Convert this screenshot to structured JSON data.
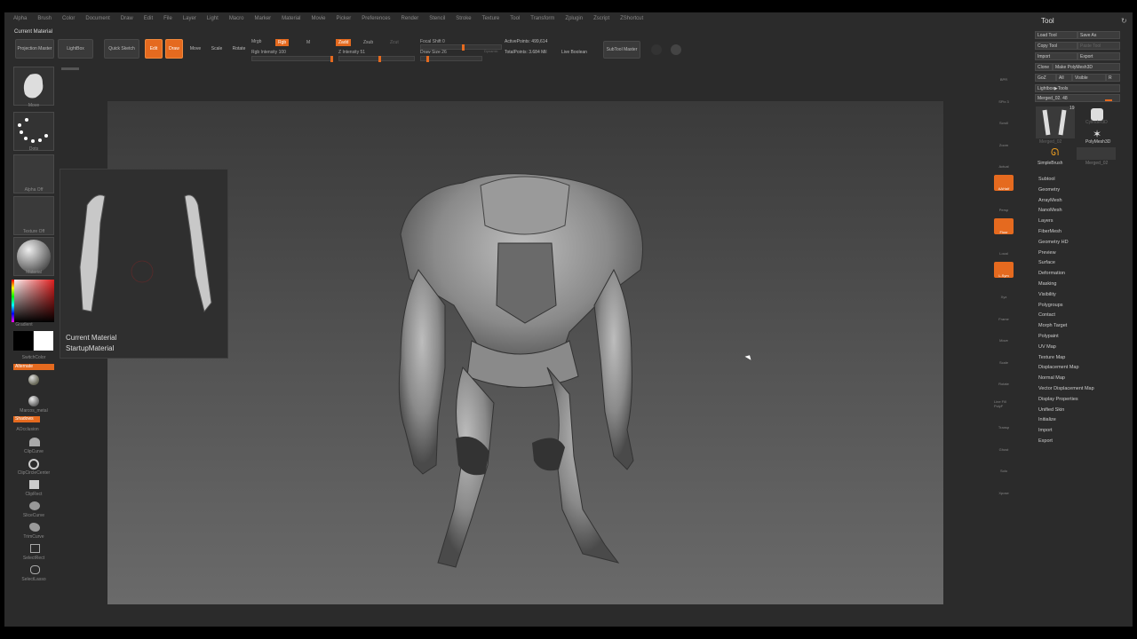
{
  "menu": [
    "Alpha",
    "Brush",
    "Color",
    "Document",
    "Draw",
    "Edit",
    "File",
    "Layer",
    "Light",
    "Macro",
    "Marker",
    "Material",
    "Movie",
    "Picker",
    "Preferences",
    "Render",
    "Stencil",
    "Stroke",
    "Texture",
    "Tool",
    "Transform",
    "Zplugin",
    "Zscript",
    "ZShortcut"
  ],
  "current_material_label": "Current Material",
  "toolbar": {
    "projection_master": "Projection Master",
    "lightbox": "LightBox",
    "quick_sketch": "Quick Sketch",
    "edit": "Edit",
    "draw": "Draw",
    "move": "Move",
    "scale": "Scale",
    "rotate": "Rotate",
    "mrgb": "Mrgb",
    "rgb": "Rgb",
    "m": "M",
    "zadd": "Zadd",
    "zsub": "Zsub",
    "zcut": "Zcut",
    "rgb_intensity": "Rgb Intensity 100",
    "z_intensity": "Z Intensity 51",
    "focal_shift": "Focal Shift 0",
    "draw_size": "Draw Size 26",
    "dynamic": "Dynamic",
    "active_points": "ActivePoints: 499,614",
    "total_points": "TotalPoints: 3.684 Mil",
    "live_boolean": "Live Boolean",
    "subtool_master": "SubTool Master"
  },
  "left_shelf": {
    "brush_label": "Move",
    "stroke_label": "Dots",
    "alpha_label": "Alpha Off",
    "texture_label": "Texture Off",
    "material_label": "Material",
    "gradient_label": "Gradient",
    "switch_color": "SwitchColor",
    "alternate": "Alternate",
    "marcos_metal": "Marcos_metal",
    "shadows": "Shadows",
    "aocclusion": "AOcclusion",
    "clip_curve": "ClipCurve",
    "clip_circle_center": "ClipCircleCenter",
    "clip_rect": "ClipRect",
    "slice_curve": "SliceCurve",
    "trim_curve": "TrimCurve",
    "select_rect": "SelectRect",
    "select_lasso": "SelectLasso"
  },
  "popup": {
    "title": "Current Material",
    "name": "StartupMaterial"
  },
  "right_shelf": [
    "BPR",
    "SPix 3",
    "Scroll",
    "Zoom",
    "Actual",
    "AAHalf",
    "Persp",
    "Floor",
    "Local",
    "L.Sym",
    "Xyz",
    "Frame",
    "Move",
    "Scale",
    "Rotate",
    "Line Fill PolyF",
    "Transp",
    "Ghost",
    "Solo",
    "Xpose"
  ],
  "tool_panel": {
    "title": "Tool",
    "load_tool": "Load Tool",
    "save_as": "Save As",
    "copy_tool": "Copy Tool",
    "paste_tool": "Paste Tool",
    "import": "Import",
    "export": "Export",
    "clone": "Clone",
    "make_polymesh": "Make PolyMesh3D",
    "goz": "GoZ",
    "all": "All",
    "visible": "Visible",
    "r": "R",
    "lightbox_tools": "Lightbox▶Tools",
    "merged_name": "Merged_02. 48",
    "thumb_merged": "Merged_02",
    "thumb_cylinder": "Cylinder3D",
    "thumb_polymesh": "PolyMesh3D",
    "thumb_simplebrush": "SimpleBrush",
    "thumb_merged2": "Merged_02",
    "thumb_count": "19",
    "menu": [
      "Subtool",
      "Geometry",
      "ArrayMesh",
      "NanoMesh",
      "Layers",
      "FiberMesh",
      "Geometry HD",
      "Preview",
      "Surface",
      "Deformation",
      "Masking",
      "Visibility",
      "Polygroups",
      "Contact",
      "Morph Target",
      "Polypaint",
      "UV Map",
      "Texture Map",
      "Displacement Map",
      "Normal Map",
      "Vector Displacement Map",
      "Display Properties",
      "Unified Skin",
      "Initialize",
      "Import",
      "Export"
    ]
  },
  "colors": {
    "accent": "#e56a1f"
  }
}
